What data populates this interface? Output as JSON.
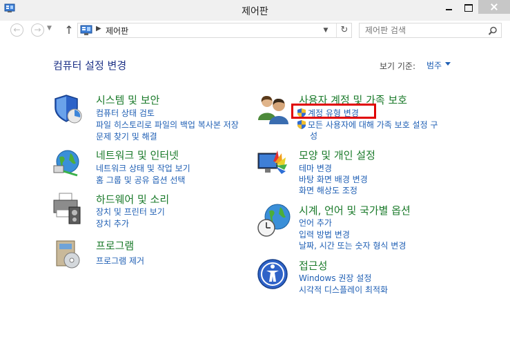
{
  "window": {
    "title": "제어판"
  },
  "address": {
    "path": "제어판"
  },
  "search": {
    "placeholder": "제어판 검색"
  },
  "header": {
    "heading": "컴퓨터 설정 변경",
    "view_by_label": "보기 기준:",
    "view_by_value": "범주"
  },
  "categories": [
    {
      "title": "시스템 및 보안",
      "links": [
        "컴퓨터 상태 검토",
        "파일 히스토리로 파일의 백업 복사본 저장",
        "문제 찾기 및 해결"
      ]
    },
    {
      "title": "네트워크 및 인터넷",
      "links": [
        "네트워크 상태 및 작업 보기",
        "홈 그룹 및 공유 옵션 선택"
      ]
    },
    {
      "title": "하드웨어 및 소리",
      "links": [
        "장치 및 프린터 보기",
        "장치 추가"
      ]
    },
    {
      "title": "프로그램",
      "links": [
        "프로그램 제거"
      ]
    },
    {
      "title": "사용자 계정 및 가족 보호",
      "links": [
        "계정 유형 변경",
        "모든 사용자에 대해 가족 보호 설정 구",
        "성"
      ]
    },
    {
      "title": "모양 및 개인 설정",
      "links": [
        "테마 변경",
        "바탕 화면 배경 변경",
        "화면 해상도 조정"
      ]
    },
    {
      "title": "시계, 언어 및 국가별 옵션",
      "links": [
        "언어 추가",
        "입력 방법 변경",
        "날짜, 시간 또는 숫자 형식 변경"
      ]
    },
    {
      "title": "접근성",
      "links": [
        "Windows 권장 설정",
        "시각적 디스플레이 최적화"
      ]
    }
  ],
  "colors": {
    "title_green": "#1a7a2a",
    "link_blue": "#1f5fb4",
    "heading_blue": "#1e3287",
    "highlight_red": "#e00000"
  }
}
